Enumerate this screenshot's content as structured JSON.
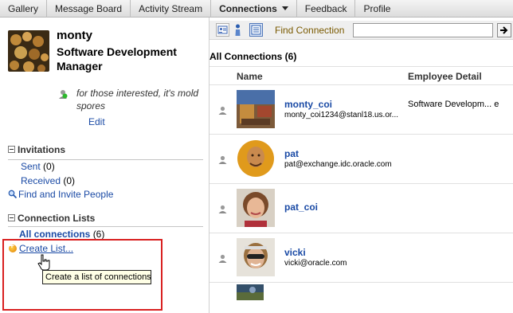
{
  "nav": {
    "items": [
      {
        "label": "Gallery"
      },
      {
        "label": "Message Board"
      },
      {
        "label": "Activity Stream"
      },
      {
        "label": "Connections",
        "active": true
      },
      {
        "label": "Feedback"
      },
      {
        "label": "Profile"
      }
    ]
  },
  "profile": {
    "name": "monty",
    "title": "Software Development Manager",
    "status": "for those interested, it's mold spores",
    "edit": "Edit"
  },
  "invitations": {
    "heading": "Invitations",
    "sent_label": "Sent",
    "sent_count": "(0)",
    "received_label": "Received",
    "received_count": "(0)",
    "find_invite": "Find and Invite People"
  },
  "lists": {
    "heading": "Connection Lists",
    "all_label": "All connections",
    "all_count": "(6)",
    "create": "Create List...",
    "tooltip": "Create a list of connections"
  },
  "toolbar": {
    "find_label": "Find Connection",
    "find_value": "",
    "go_icon": "arrow-right-icon"
  },
  "connections": {
    "heading": "All Connections (6)",
    "col_name": "Name",
    "col_detail": "Employee Detail",
    "rows": [
      {
        "name": "monty_coi",
        "email": "monty_coi1234@stanl18.us.or...",
        "detail": "Software Developm... e"
      },
      {
        "name": "pat",
        "email": "pat@exchange.idc.oracle.com",
        "detail": ""
      },
      {
        "name": "pat_coi",
        "email": "",
        "detail": ""
      },
      {
        "name": "vicki",
        "email": "vicki@oracle.com",
        "detail": ""
      }
    ]
  },
  "colors": {
    "link": "#1a4aa5",
    "highlight": "#d92020"
  }
}
